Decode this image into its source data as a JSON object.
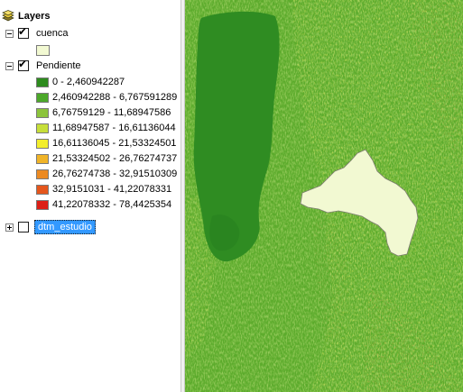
{
  "toc": {
    "title": "Layers",
    "layers": [
      {
        "name": "cuenca",
        "checked": true,
        "expanded": true
      },
      {
        "name": "Pendiente",
        "checked": true,
        "expanded": true
      },
      {
        "name": "dtm_estudio",
        "checked": false,
        "expanded": false,
        "selected": true
      }
    ],
    "cuenca_symbol_color": "#f2f9d2",
    "pendiente_classes": [
      {
        "label": "0 - 2,460942287",
        "color": "#2e8c1e"
      },
      {
        "label": "2,460942288 - 6,767591289",
        "color": "#4ca82a"
      },
      {
        "label": "6,76759129 - 11,68947586",
        "color": "#8cc43c"
      },
      {
        "label": "11,68947587 - 16,61136044",
        "color": "#c7df3a"
      },
      {
        "label": "16,61136045 - 21,53324501",
        "color": "#f3ee2c"
      },
      {
        "label": "21,53324502 - 26,76274737",
        "color": "#f0b428"
      },
      {
        "label": "26,76274738 - 32,91510309",
        "color": "#ec8a22"
      },
      {
        "label": "32,9151031 - 41,22078331",
        "color": "#e5561c"
      },
      {
        "label": "41,22078332 - 78,4425354",
        "color": "#dc1f16"
      }
    ],
    "selected_highlight_color": "#3399ff",
    "check_glyph": "✔"
  }
}
